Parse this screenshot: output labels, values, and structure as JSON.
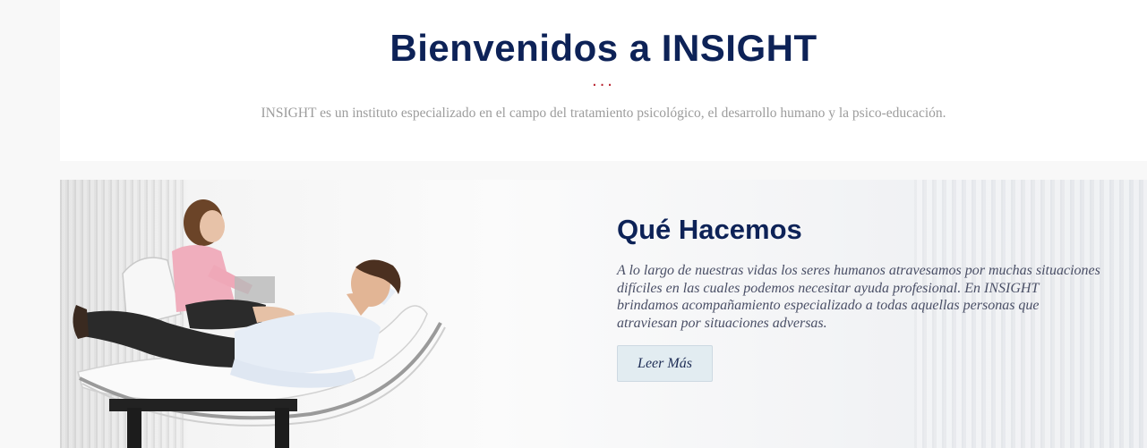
{
  "welcome": {
    "title": "Bienvenidos a INSIGHT",
    "divider": "...",
    "description": "INSIGHT es un instituto especializado en el campo del tratamiento psicológico, el desarrollo humano y la psico-educación."
  },
  "what_we_do": {
    "title": "Qué Hacemos",
    "text": "A lo largo de nuestras vidas los seres humanos atravesamos por muchas situaciones difíciles en las cuales podemos necesitar ayuda profesional. En INSIGHT brindamos acompañamiento especializado a todas aquellas personas que atraviesan por situaciones adversas.",
    "button_label": "Leer Más",
    "image_icon": "therapy-session-photo"
  },
  "colors": {
    "heading": "#0d2257",
    "accent": "#b8232f",
    "muted_text": "#9c9c9c",
    "button_bg": "#e2ecf1"
  }
}
